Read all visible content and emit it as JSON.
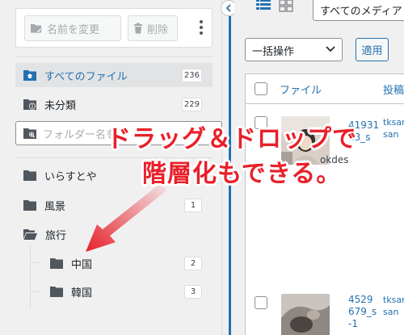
{
  "toolbar": {
    "rename_label": "名前を変更",
    "delete_label": "削除"
  },
  "nav": {
    "all_files": {
      "label": "すべてのファイル",
      "count": "236"
    },
    "uncategorized": {
      "label": "未分類",
      "count": "229"
    }
  },
  "search": {
    "placeholder": "フォルダー名を"
  },
  "folders": [
    {
      "label": "いらすとや",
      "count": ""
    },
    {
      "label": "風景",
      "count": "1"
    },
    {
      "label": "旅行",
      "count": ""
    },
    {
      "label": "中国",
      "count": "2"
    },
    {
      "label": "韓国",
      "count": "3"
    }
  ],
  "media": {
    "filter_value": "すべてのメディア",
    "bulk_action": "一括操作",
    "apply_label": "適用",
    "column_file": "ファイル",
    "column_author": "投稿",
    "rows": [
      {
        "name": "4193113_s",
        "name_line1": "41931",
        "name_line2": "13_s",
        "ext": "okdes",
        "author_line1": "tksar",
        "author_line2": "san"
      },
      {
        "name": "4529679_s-1",
        "name_line1": "4529",
        "name_line2": "679_s",
        "name_line3": "-1",
        "author_line1": "tksar",
        "author_line2": "san"
      }
    ]
  },
  "annotation": {
    "line1": "ドラッグ＆ドロップで",
    "line2": "階層化もできる。",
    "color": "#e8202a"
  },
  "colors": {
    "accent": "#2271b1",
    "panel_bg": "#f0f0f1"
  }
}
